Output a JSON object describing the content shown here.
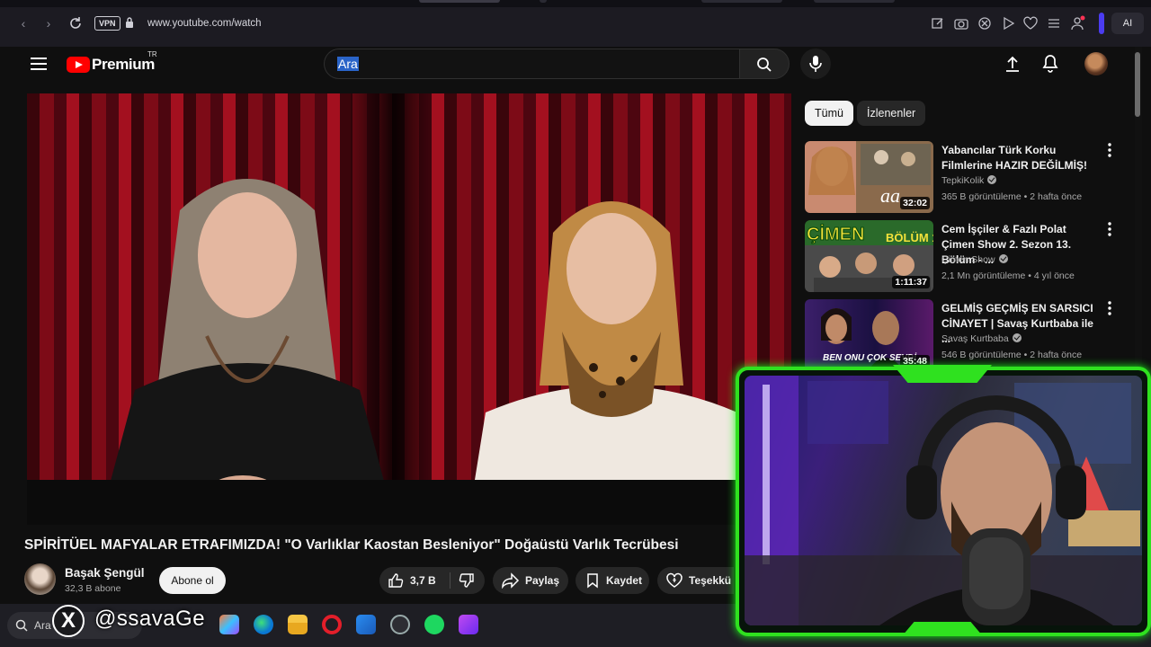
{
  "browser": {
    "url": "www.youtube.com/watch",
    "vpn_label": "VPN",
    "ai_label": "AI"
  },
  "header": {
    "brand": "Premium",
    "country_code": "TR",
    "search_value": "Ara"
  },
  "video": {
    "title": "SPİRİTÜEL MAFYALAR ETRAFIMIZDA! \"O Varlıklar Kaostan Besleniyor\" Doğaüstü Varlık Tecrübesi",
    "channel_name": "Başak Şengül",
    "subscribers": "32,3 B abone",
    "subscribe_label": "Abone ol",
    "like_count": "3,7 B",
    "share_label": "Paylaş",
    "save_label": "Kaydet",
    "thanks_label": "Teşekkü"
  },
  "sidebar": {
    "chips": [
      {
        "label": "Tümü",
        "active": true
      },
      {
        "label": "İzlenenler",
        "active": false
      }
    ],
    "recommendations": [
      {
        "title": "Yabancılar Türk Korku Filmlerine HAZIR DEĞİLMİŞ!",
        "channel": "TepkiKolik",
        "meta": "365 B görüntüleme • 2 hafta önce",
        "duration": "32:02"
      },
      {
        "title": "Cem İşçiler & Fazlı Polat Çimen Show 2. Sezon 13. Bölüm - ...",
        "channel": "Çimen Show",
        "meta": "2,1 Mn görüntüleme • 4 yıl önce",
        "duration": "1:11:37"
      },
      {
        "title": "GELMİŞ GEÇMİŞ EN SARSICI CİNAYET | Savaş Kurtbaba ile ...",
        "channel": "Savaş Kurtbaba",
        "meta": "546 B görüntüleme • 2 hafta önce",
        "duration": "35:48"
      }
    ]
  },
  "taskbar": {
    "search_label": "Ara"
  },
  "overlay": {
    "x_glyph": "X",
    "handle": "@ssavaGe"
  },
  "colors": {
    "youtube_red": "#ff0000",
    "webcam_frame": "#2fe11f",
    "background": "#0f0f0f"
  }
}
